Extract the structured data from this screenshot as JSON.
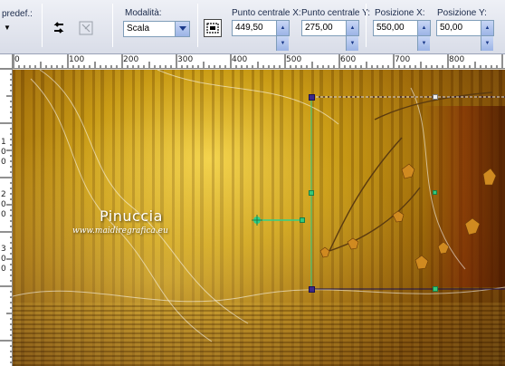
{
  "toolbar": {
    "preset_label": "predef.:",
    "mode_label": "Modalità:",
    "mode_value": "Scala",
    "center_x_label": "Punto centrale X:",
    "center_x_value": "449,50",
    "center_y_label": "Punto centrale Y:",
    "center_y_value": "275,00",
    "pos_x_label": "Posizione X:",
    "pos_x_value": "550,00",
    "pos_y_label": "Posizione Y:",
    "pos_y_value": "50,00"
  },
  "icons": {
    "reset": "reset-icon",
    "transform": "transform-icon",
    "projection": "projection-icon"
  },
  "ruler": {
    "top_ticks": [
      "0",
      "100",
      "200",
      "300",
      "400",
      "500",
      "600",
      "700",
      "800"
    ],
    "left_ticks": [
      "1",
      "0",
      "0",
      "2",
      "0",
      "0",
      "3",
      "0",
      "0"
    ]
  },
  "canvas": {
    "watermark_name": "Pinuccia",
    "watermark_url": "www.maidiregrafica.eu"
  },
  "colors": {
    "selection": "#3a2a8a",
    "handle": "#34c97a",
    "accent_axis": "#2fd28a"
  }
}
